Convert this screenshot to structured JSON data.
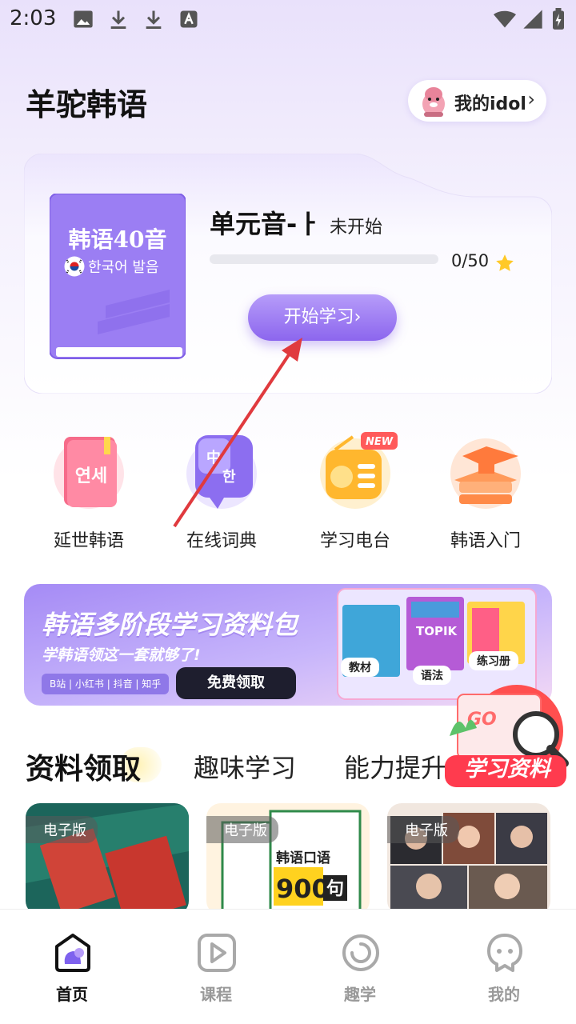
{
  "status_bar": {
    "time": "2:03",
    "icons": [
      "image-icon",
      "download-icon",
      "download-icon",
      "a-icon",
      "wifi-icon",
      "signal-icon",
      "battery-icon"
    ]
  },
  "header": {
    "title": "羊驼韩语",
    "idol_button": "我的idol"
  },
  "course": {
    "book_title": "韩语40音",
    "book_subtitle": "한국어 발음",
    "lesson_title": "单元音-ㅏ",
    "lesson_status": "未开始",
    "progress_text": "0/50",
    "progress_fraction": 0,
    "start_button": "开始学习"
  },
  "quick_links": [
    {
      "label": "延世韩语",
      "icon_text": "연세",
      "icon": "book-icon"
    },
    {
      "label": "在线词典",
      "icon_text_a": "中",
      "icon_text_b": "한",
      "icon": "dictionary-icon"
    },
    {
      "label": "学习电台",
      "badge": "NEW",
      "icon": "radio-icon"
    },
    {
      "label": "韩语入门",
      "icon": "books-stack-icon"
    }
  ],
  "banner": {
    "title": "韩语多阶段学习资料包",
    "subtitle": "学韩语领这一套就够了!",
    "tags": "B站 | 小红书 | 抖音 | 知乎",
    "button": "免费领取",
    "book_labels": [
      "教材",
      "语法",
      "练习册"
    ],
    "book_text": "TOPIK"
  },
  "tabs": [
    "资料领取",
    "趣味学习",
    "能力提升"
  ],
  "float_ad": {
    "label": "学习资料",
    "go_text": "GO"
  },
  "resources": [
    {
      "badge": "电子版"
    },
    {
      "badge": "电子版",
      "cover_text": "韩语口语",
      "cover_number": "900",
      "cover_char": "句"
    },
    {
      "badge": "电子版"
    }
  ],
  "bottom_nav": [
    {
      "label": "首页",
      "icon": "home-icon",
      "active": true
    },
    {
      "label": "课程",
      "icon": "play-icon",
      "active": false
    },
    {
      "label": "趣学",
      "icon": "circle-icon",
      "active": false
    },
    {
      "label": "我的",
      "icon": "profile-icon",
      "active": false
    }
  ],
  "colors": {
    "accent": "#8c66ee",
    "accent_light": "#b69cf9",
    "book": "#9b7ef3",
    "nav_active": "#111111",
    "nav_inactive": "#999999"
  }
}
